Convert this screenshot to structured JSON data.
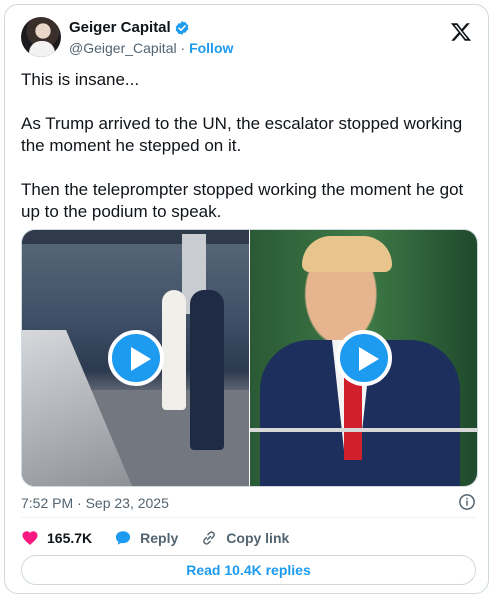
{
  "author": {
    "display_name": "Geiger Capital",
    "handle": "@Geiger_Capital",
    "separator": "·",
    "follow_label": "Follow"
  },
  "tweet": {
    "text": "This is insane...\n\nAs Trump arrived to the UN, the escalator stopped working the moment he stepped on it.\n\nThen the teleprompter stopped working the moment he got up to the podium to speak.",
    "timestamp": "7:52 PM · Sep 23, 2025"
  },
  "actions": {
    "like_count": "165.7K",
    "reply_label": "Reply",
    "copy_link_label": "Copy link"
  },
  "read_replies_label": "Read 10.4K replies",
  "icons": {
    "verified": "verified-badge-icon",
    "x_logo": "x-logo-icon",
    "play": "play-icon",
    "info": "info-icon",
    "heart": "heart-icon",
    "reply": "reply-bubble-icon",
    "link": "link-icon"
  },
  "colors": {
    "accent": "#1d9bf0",
    "like": "#f91880",
    "muted": "#536471",
    "text": "#0f1419"
  }
}
